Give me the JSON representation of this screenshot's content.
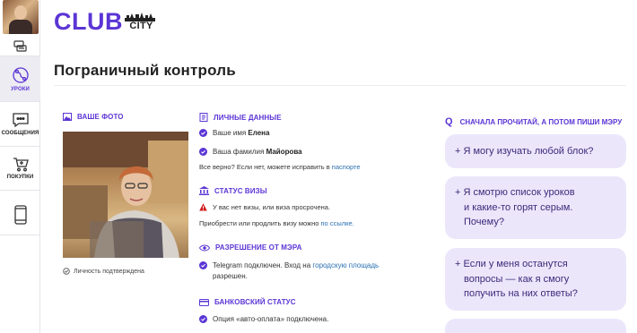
{
  "sidebar": {
    "items": [
      {
        "label": "",
        "icon": "coins-icon"
      },
      {
        "label": "УРОКИ",
        "icon": "route-icon"
      },
      {
        "label": "СООБЩЕНИЯ",
        "icon": "chat-icon"
      },
      {
        "label": "ПОКУПКИ",
        "icon": "cart-icon"
      },
      {
        "label": "",
        "icon": "phone-icon"
      }
    ]
  },
  "logo": {
    "club": "CLUB",
    "city": "CITY"
  },
  "page_title": "Пограничный контроль",
  "photo_section": {
    "heading": "ВАШЕ ФОТО",
    "confirmed": "Личность подтверждена"
  },
  "personal": {
    "heading": "ЛИЧНЫЕ ДАННЫЕ",
    "name_label": "Ваше имя",
    "name_value": "Елена",
    "surname_label": "Ваша фамилия",
    "surname_value": "Майорова",
    "check_text": "Все верно? Если нет, можете исправить в",
    "check_link": "паспорте"
  },
  "visa": {
    "heading": "СТАТУС ВИЗЫ",
    "warning": "У вас нет визы, или виза просрочена.",
    "extend_text": "Приобрести или продлить визу можно",
    "extend_link": "по ссылке."
  },
  "mayor": {
    "heading": "РАЗРЕШЕНИЕ ОТ МЭРА",
    "line1_text": "Telegram подключен. Вход на",
    "line1_link": "городскую площадь",
    "line2": "разрешен."
  },
  "bank": {
    "heading": "БАНКОВСКИЙ СТАТУС",
    "line": "Опция «авто-оплата» подключена."
  },
  "faq": {
    "icon_letter": "Q",
    "heading": "СНАЧАЛА ПРОЧИТАЙ, А ПОТОМ ПИШИ МЭРУ",
    "cards": [
      {
        "lines": [
          "+ Я могу изучать любой блок?"
        ]
      },
      {
        "lines": [
          "+ Я смотрю список уроков",
          "и какие-то горят серым.",
          "Почему?"
        ]
      },
      {
        "lines": [
          "+ Если у меня останутся",
          "вопросы — как я смогу",
          "получить на них ответы?"
        ]
      }
    ]
  },
  "colors": {
    "accent": "#5b35d5",
    "card_bg": "#ece6fb",
    "link": "#2a6fb0",
    "warning": "#d11a1a"
  }
}
